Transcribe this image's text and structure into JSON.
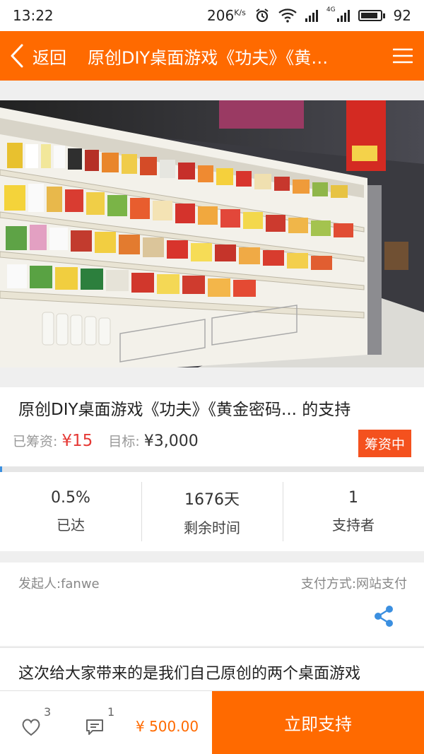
{
  "status_bar": {
    "time": "13:22",
    "net_speed": "206",
    "net_unit": "K/s",
    "net_type": "4G",
    "battery": "92",
    "battery_level": 0.92
  },
  "top_bar": {
    "back_label": "返回",
    "title": "原创DIY桌面游戏《功夫》《黄…"
  },
  "project": {
    "title": "原创DIY桌面游戏《功夫》《黄金密码... 的支持",
    "raised_label": "已筹资:",
    "raised_value": "¥15",
    "goal_label": "目标:",
    "goal_value": "¥3,000",
    "status_badge": "筹资中",
    "progress_fraction": 0.005
  },
  "stats": [
    {
      "value": "0.5%",
      "label": "已达"
    },
    {
      "value": "1676天",
      "label": "剩余时间"
    },
    {
      "value": "1",
      "label": "支持者"
    }
  ],
  "meta": {
    "initiator": "发起人:fanwe",
    "payment": "支付方式:网站支付"
  },
  "description": "这次给大家带来的是我们自己原创的两个桌面游戏",
  "bottom_bar": {
    "like_count": "3",
    "comment_count": "1",
    "price": "¥ 500.00",
    "support_button": "立即支持"
  },
  "colors": {
    "accent": "#ff6a00",
    "badge": "#f4511e",
    "raised": "#e53935",
    "progress": "#3b8fe0",
    "share_icon": "#3b8fe0"
  }
}
